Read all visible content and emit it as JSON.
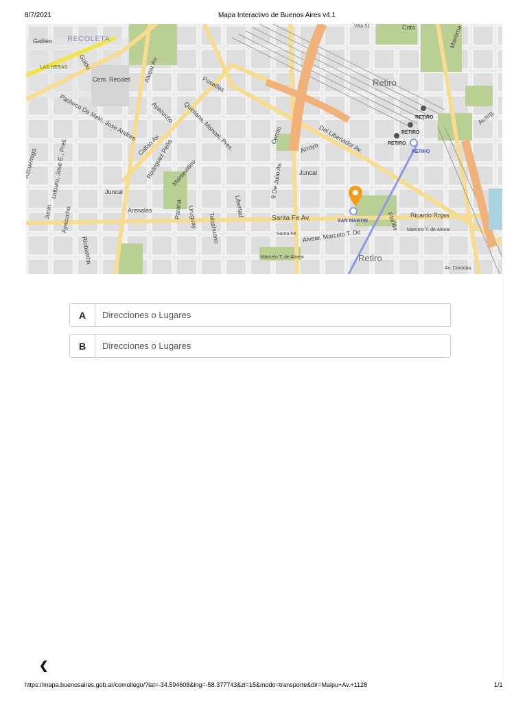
{
  "print_header": {
    "date": "8/7/2021",
    "title": "Mapa Interactivo de Buenos Aires v4.1"
  },
  "map": {
    "labels": [
      "RECOLETA",
      "Galileo",
      "LAS HERAS",
      "Cem. Recolet",
      "Alvear Av.",
      "Callao Av.",
      "Posadas",
      "Quintana, Manuel, Pres.",
      "Ayacucho",
      "Rodriguez Peña",
      "Montevideo",
      "Cerrito",
      "Arroyo",
      "Del Libertador Av.",
      "Retiro",
      "RETIRO",
      "RETIRO",
      "RETIRO",
      "RETIRO",
      "9 De Julio Av.",
      "Juncal",
      "Libertad",
      "Talcahuano",
      "Uruguay",
      "Parana",
      "Santa Fe Av.",
      "SAN MARTIN",
      "Florida",
      "Ricardo Rojas",
      "Marcelo T. de Alvear",
      "Alvear, Marcelo T. De",
      "Retiro",
      "Av. Cordoba",
      "Marcelo T. de Alvear",
      "Arenales",
      "Junin",
      "Ayacucho",
      "Riobamba",
      "Uriburu, Jose E., Pres.",
      "Pacheco De Melo, Jose Andres",
      "Azcuenaga",
      "Guido",
      "Av.Ing.",
      "Santa Fe",
      "Juncal",
      "Villa 31",
      "Coto",
      "Maritima"
    ],
    "marker_color": "#f39c12",
    "subway_color": "#8c97e6"
  },
  "route": {
    "a": {
      "letter": "A",
      "placeholder": "Direcciones o Lugares",
      "value": ""
    },
    "b": {
      "letter": "B",
      "placeholder": "Direcciones o Lugares",
      "value": ""
    }
  },
  "back_icon": "chevron-left-icon",
  "print_footer": {
    "url": "https://mapa.buenosaires.gob.ar/comollego/?lat=-34.594608&lng=-58.377743&zl=15&modo=transporte&dir=Maipu+Av.+1128",
    "page": "1/1"
  }
}
